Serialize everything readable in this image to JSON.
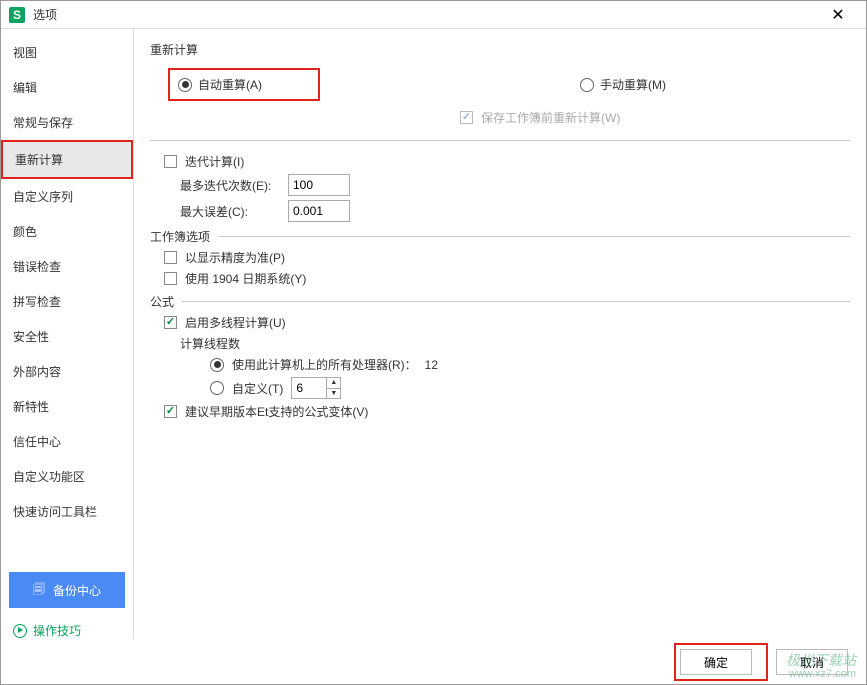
{
  "window": {
    "title": "选项"
  },
  "sidebar": {
    "items": [
      "视图",
      "编辑",
      "常规与保存",
      "重新计算",
      "自定义序列",
      "颜色",
      "错误检查",
      "拼写检查",
      "安全性",
      "外部内容",
      "新特性",
      "信任中心",
      "自定义功能区",
      "快速访问工具栏"
    ],
    "backup": "备份中心",
    "tips": "操作技巧"
  },
  "recalc": {
    "legend": "重新计算",
    "auto": "自动重算(A)",
    "manual": "手动重算(M)",
    "saveRecalc": "保存工作簿前重新计算(W)"
  },
  "iter": {
    "iterLabel": "迭代计算(I)",
    "maxIterLabel": "最多迭代次数(E):",
    "maxIterVal": "100",
    "maxErrLabel": "最大误差(C):",
    "maxErrVal": "0.001"
  },
  "workbook": {
    "legend": "工作簿选项",
    "precision": "以显示精度为准(P)",
    "date1904": "使用 1904 日期系统(Y)"
  },
  "formula": {
    "legend": "公式",
    "multithread": "启用多线程计算(U)",
    "threadsLabel": "计算线程数",
    "allProc": "使用此计算机上的所有处理器(R)：",
    "procCount": "12",
    "custom": "自定义(T)",
    "customVal": "6",
    "compat": "建议早期版本Et支持的公式变体(V)"
  },
  "footer": {
    "ok": "确定",
    "cancel": "取消"
  },
  "watermark": {
    "l1": "极光下载站",
    "l2": "www.xz7.com"
  }
}
